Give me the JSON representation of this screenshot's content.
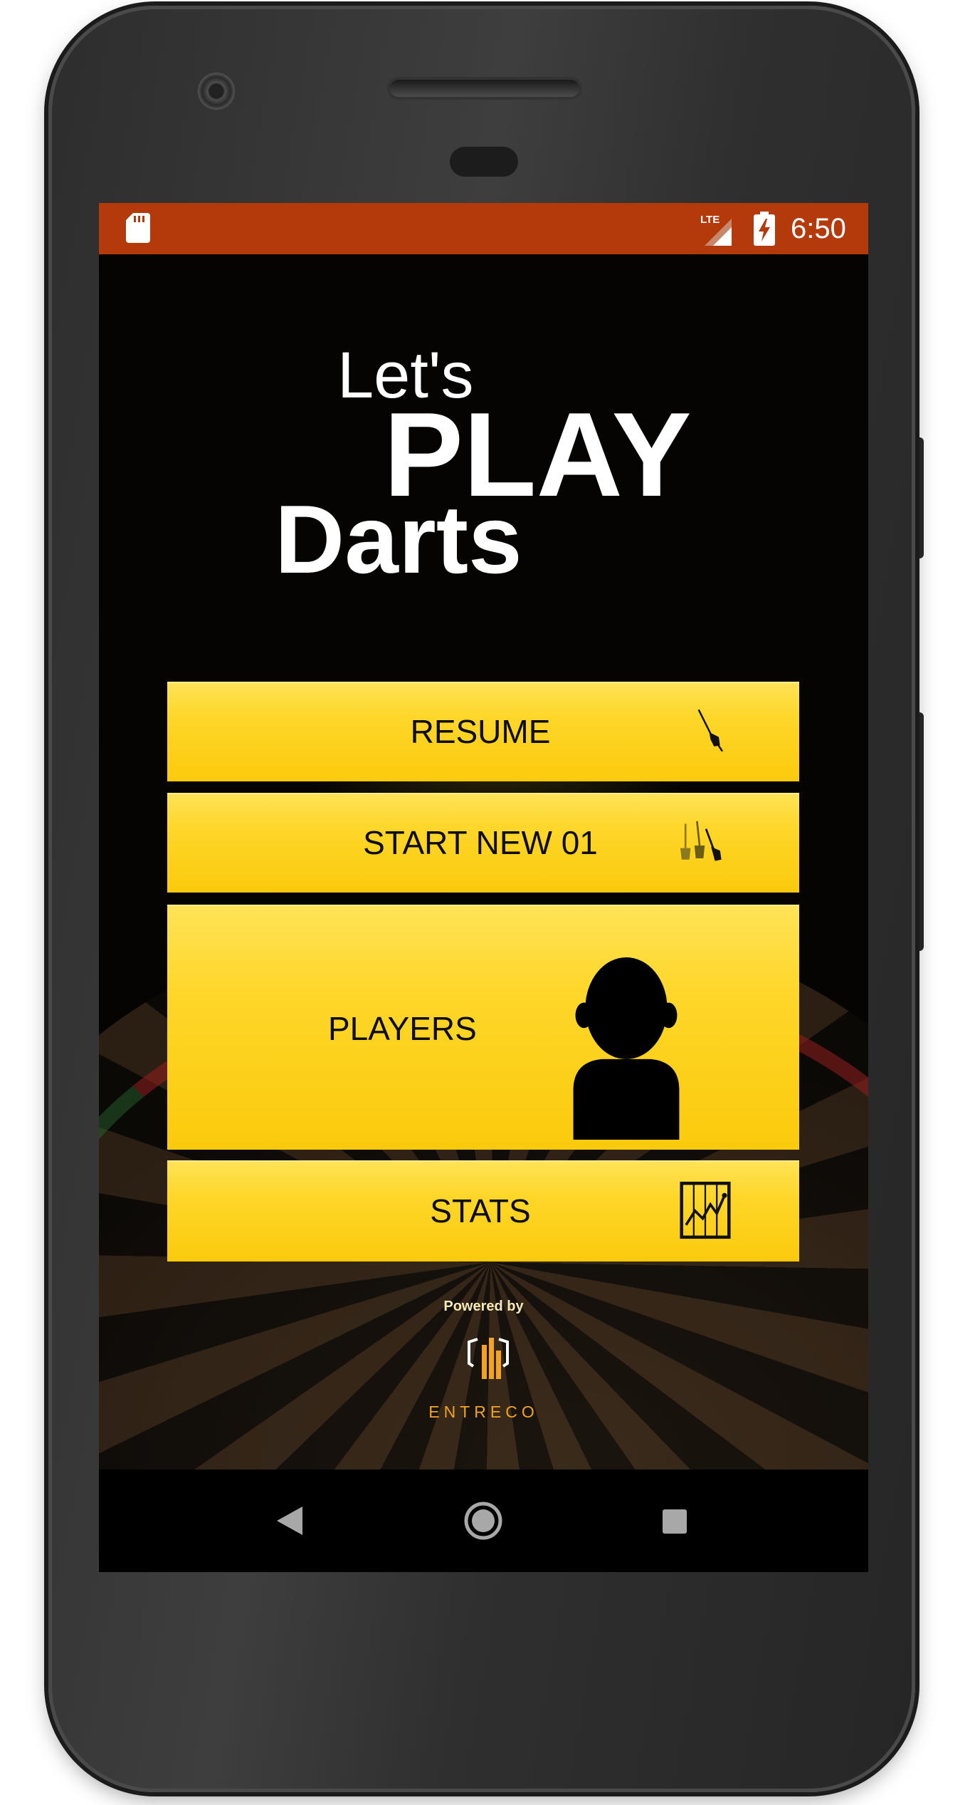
{
  "status_bar": {
    "time": "6:50",
    "network": "LTE",
    "icons": [
      "sd-card-icon",
      "lte-signal-icon",
      "battery-charging-icon"
    ],
    "color": "#b43a0c"
  },
  "title": {
    "line1": "Let's",
    "line2": "PLAY",
    "line3": "Darts"
  },
  "menu": {
    "resume_label": "RESUME",
    "start_new_label": "START NEW 01",
    "players_label": "PLAYERS",
    "stats_label": "STATS",
    "button_color": "#fcd116",
    "icons": [
      "dart-icon",
      "three-darts-icon",
      "player-silhouette-icon",
      "stats-chart-icon"
    ]
  },
  "footer": {
    "powered_by": "Powered by",
    "brand_name": "ENTRECO",
    "brand_color": "#f2a41e"
  },
  "nav_bar": {
    "icons": [
      "back-icon",
      "home-icon",
      "recents-icon"
    ]
  }
}
